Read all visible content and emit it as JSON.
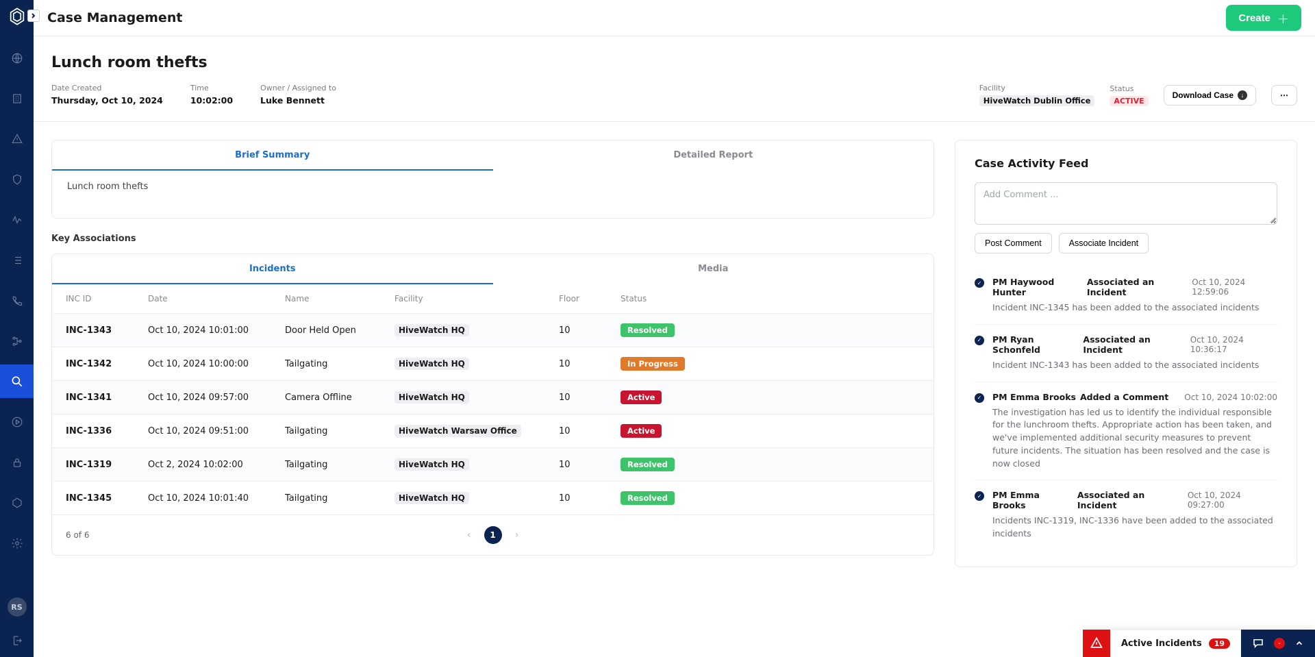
{
  "page_title": "Case Management",
  "create_label": "Create",
  "case": {
    "title": "Lunch room thefts",
    "meta": {
      "date_created_label": "Date Created",
      "date_created": "Thursday, Oct 10, 2024",
      "time_label": "Time",
      "time": "10:02:00",
      "owner_label": "Owner / Assigned to",
      "owner": "Luke Bennett",
      "facility_label": "Facility",
      "facility": "HiveWatch Dublin Office",
      "status_label": "Status",
      "status": "ACTIVE"
    },
    "download_label": "Download Case"
  },
  "summary": {
    "tab_brief": "Brief Summary",
    "tab_detailed": "Detailed Report",
    "body": "Lunch room thefts"
  },
  "associations": {
    "section_label": "Key Associations",
    "tab_incidents": "Incidents",
    "tab_media": "Media",
    "columns": {
      "id": "INC ID",
      "date": "Date",
      "name": "Name",
      "facility": "Facility",
      "floor": "Floor",
      "status": "Status"
    },
    "rows": [
      {
        "id": "INC-1343",
        "date": "Oct 10, 2024 10:01:00",
        "name": "Door Held Open",
        "facility": "HiveWatch HQ",
        "floor": "10",
        "status": "Resolved",
        "status_class": "resolved"
      },
      {
        "id": "INC-1342",
        "date": "Oct 10, 2024 10:00:00",
        "name": "Tailgating",
        "facility": "HiveWatch HQ",
        "floor": "10",
        "status": "In Progress",
        "status_class": "inprogress"
      },
      {
        "id": "INC-1341",
        "date": "Oct 10, 2024 09:57:00",
        "name": "Camera Offline",
        "facility": "HiveWatch HQ",
        "floor": "10",
        "status": "Active",
        "status_class": "activeb"
      },
      {
        "id": "INC-1336",
        "date": "Oct 10, 2024 09:51:00",
        "name": "Tailgating",
        "facility": "HiveWatch Warsaw Office",
        "floor": "10",
        "status": "Active",
        "status_class": "activeb"
      },
      {
        "id": "INC-1319",
        "date": "Oct 2, 2024 10:02:00",
        "name": "Tailgating",
        "facility": "HiveWatch HQ",
        "floor": "10",
        "status": "Resolved",
        "status_class": "resolved"
      },
      {
        "id": "INC-1345",
        "date": "Oct 10, 2024 10:01:40",
        "name": "Tailgating",
        "facility": "HiveWatch HQ",
        "floor": "10",
        "status": "Resolved",
        "status_class": "resolved"
      }
    ],
    "footer_count": "6 of 6",
    "page_num": "1"
  },
  "feed": {
    "title": "Case Activity Feed",
    "comment_placeholder": "Add Comment ...",
    "post_label": "Post Comment",
    "associate_label": "Associate Incident",
    "items": [
      {
        "who": "PM Haywood Hunter",
        "what": "Associated an Incident",
        "when": "Oct 10, 2024 12:59:06",
        "text": "Incident INC-1345 has been added to the associated incidents"
      },
      {
        "who": "PM Ryan Schonfeld",
        "what": "Associated an Incident",
        "when": "Oct 10, 2024 10:36:17",
        "text": "Incident INC-1343 has been added to the associated incidents"
      },
      {
        "who": "PM Emma Brooks",
        "what": "Added a Comment",
        "when": "Oct 10, 2024 10:02:00",
        "text": "The investigation has led us to identify the individual responsible for the lunchroom thefts. Appropriate action has been taken, and we've implemented additional security measures to prevent future incidents. The situation has been resolved and the case is now closed"
      },
      {
        "who": "PM Emma Brooks",
        "what": "Associated an Incident",
        "when": "Oct 10, 2024 09:27:00",
        "text": "Incidents INC-1319, INC-1336 have been added to the associated incidents"
      }
    ]
  },
  "bottom_bar": {
    "label": "Active Incidents",
    "count": "19",
    "msg_count": "-"
  },
  "avatar_initials": "RS"
}
